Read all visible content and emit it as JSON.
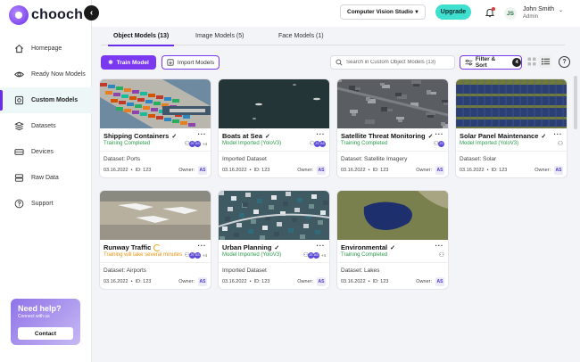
{
  "app": {
    "logo_text": "chooch",
    "collapse_icon": "chevron-left-icon"
  },
  "sidebar": {
    "items": [
      {
        "label": "Homepage",
        "icon": "home-icon",
        "active": false
      },
      {
        "label": "Ready Now Models",
        "icon": "eye-icon",
        "active": false
      },
      {
        "label": "Custom Models",
        "icon": "custom-models-icon",
        "active": true
      },
      {
        "label": "Datasets",
        "icon": "layers-icon",
        "active": false
      },
      {
        "label": "Devices",
        "icon": "device-icon",
        "active": false
      },
      {
        "label": "Raw Data",
        "icon": "database-icon",
        "active": false
      },
      {
        "label": "Support",
        "icon": "support-icon",
        "active": false
      }
    ],
    "help": {
      "title": "Need help?",
      "subtitle": "Connect with us",
      "button": "Contact"
    }
  },
  "topbar": {
    "studio_select": "Computer Vision Studio",
    "upgrade": "Upgrade",
    "user_initials": "JS",
    "user_name": "John Smith",
    "user_role": "Admin"
  },
  "tabs": [
    {
      "label": "Object Models (13)",
      "active": true
    },
    {
      "label": "Image Models (5)",
      "active": false
    },
    {
      "label": "Face Models (1)",
      "active": false
    }
  ],
  "toolbar": {
    "train_label": "Train Model",
    "import_label": "Import Models",
    "search_placeholder": "Search in Custom Object Models (13)",
    "filter_label": "Filter & Sort",
    "filter_count": "4",
    "help_label": "?"
  },
  "cards": [
    {
      "title": "Shipping Containers",
      "title_icon": "check",
      "status": "Training Completed",
      "status_color": "green",
      "dataset": "Dataset: Ports",
      "date": "03.16.2022",
      "id": "ID: 123",
      "owner_label": "Owner:",
      "owner": "AS",
      "users": [
        "JS",
        "AS"
      ],
      "extra_users": "+4",
      "image": "containers"
    },
    {
      "title": "Boats at Sea",
      "title_icon": "check",
      "status": "Model Imported (YoloV3)",
      "status_color": "green",
      "dataset": "Imported Dataset",
      "date": "03.16.2022",
      "id": "ID: 123",
      "owner_label": "Owner:",
      "owner": "AS",
      "users": [
        "JS",
        "AS"
      ],
      "extra_users": "",
      "image": "sea"
    },
    {
      "title": "Satellite Threat Monitoring",
      "title_icon": "check",
      "status": "Training Completed",
      "status_color": "green",
      "dataset": "Dataset: Satellite Imagery",
      "date": "03.16.2022",
      "id": "ID: 123",
      "owner_label": "Owner:",
      "owner": "AS",
      "users": [
        "JS"
      ],
      "extra_users": "",
      "image": "satellite"
    },
    {
      "title": "Solar Panel Maintenance",
      "title_icon": "check",
      "status": "Model Imported (YoloV3)",
      "status_color": "green",
      "dataset": "Dataset: Solar",
      "date": "03.16.2022",
      "id": "ID: 123",
      "owner_label": "Owner:",
      "owner": "AS",
      "users": [],
      "extra_users": "",
      "image": "solar"
    },
    {
      "title": "Runway Traffic",
      "title_icon": "spinner",
      "status": "Training will take several minutes",
      "status_color": "orange",
      "dataset": "Dataset: Airports",
      "date": "03.16.2022",
      "id": "ID: 123",
      "owner_label": "Owner:",
      "owner": "AS",
      "users": [
        "JS",
        "AS"
      ],
      "extra_users": "+4",
      "image": "runway"
    },
    {
      "title": "Urban Planning",
      "title_icon": "check",
      "status": "Model Imported (YoloV3)",
      "status_color": "green",
      "dataset": "Imported Dataset",
      "date": "03.16.2022",
      "id": "ID: 123",
      "owner_label": "Owner:",
      "owner": "AS",
      "users": [
        "JS",
        "AS"
      ],
      "extra_users": "+4",
      "image": "urban"
    },
    {
      "title": "Environmental",
      "title_icon": "check",
      "status": "Training Completed",
      "status_color": "green",
      "dataset": "Dataset: Lakes",
      "date": "03.16.2022",
      "id": "ID: 123",
      "owner_label": "Owner:",
      "owner": "AS",
      "users": [],
      "extra_users": "",
      "image": "lake"
    }
  ],
  "colors": {
    "accent": "#7a38f0",
    "upgrade": "#3fe0cf",
    "success": "#2a9a4a",
    "warning": "#e8920f"
  }
}
